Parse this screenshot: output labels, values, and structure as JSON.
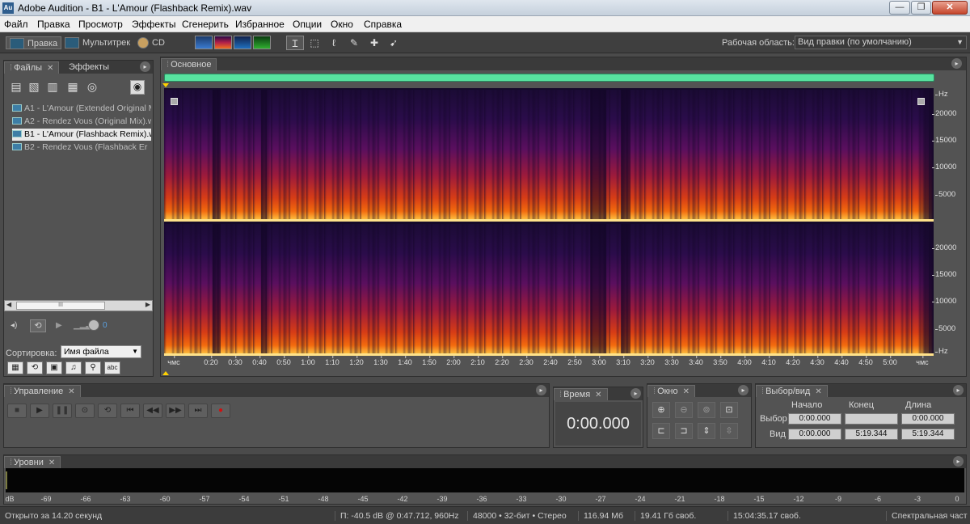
{
  "window": {
    "app_icon": "Au",
    "title": "Adobe Audition - B1 - L'Amour (Flashback Remix).wav",
    "min": "—",
    "max": "❐",
    "close": "✕"
  },
  "menu": [
    "Файл",
    "Правка",
    "Просмотр",
    "Эффекты",
    "Сгенерить",
    "Избранное",
    "Опции",
    "Окно",
    "Справка"
  ],
  "toolbar": {
    "edit": "Правка",
    "multitrack": "Мультитрек",
    "cd": "CD",
    "workspace_label": "Рабочая область:",
    "workspace_value": "Вид правки (по умолчанию)"
  },
  "files_panel": {
    "tab_files": "Файлы",
    "tab_effects": "Эффекты",
    "items": [
      {
        "label": "A1 - L'Amour (Extended Original M",
        "selected": false
      },
      {
        "label": "A2 - Rendez Vous (Original Mix).w",
        "selected": false
      },
      {
        "label": "B1 - L'Amour (Flashback Remix).w",
        "selected": true
      },
      {
        "label": "B2 - Rendez Vous (Flashback Er",
        "selected": false
      }
    ],
    "scroll_grip": "III",
    "sort_label": "Сортировка:",
    "sort_value": "Имя файла"
  },
  "editor": {
    "tab": "Основное",
    "hz_unit": "Hz",
    "channel1_hz": [
      "20000",
      "15000",
      "10000",
      "5000"
    ],
    "channel2_hz": [
      "20000",
      "15000",
      "10000",
      "5000"
    ],
    "time_unit": "чмс",
    "time_ticks": [
      "0:20",
      "0:30",
      "0:40",
      "0:50",
      "1:00",
      "1:10",
      "1:20",
      "1:30",
      "1:40",
      "1:50",
      "2:00",
      "2:10",
      "2:20",
      "2:30",
      "2:40",
      "2:50",
      "3:00",
      "3:10",
      "3:20",
      "3:30",
      "3:40",
      "3:50",
      "4:00",
      "4:10",
      "4:20",
      "4:30",
      "4:40",
      "4:50",
      "5:00"
    ]
  },
  "transport": {
    "tab": "Управление"
  },
  "time_panel": {
    "tab": "Время",
    "value": "0:00.000"
  },
  "zoom_panel": {
    "tab": "Окно"
  },
  "selection_panel": {
    "tab": "Выбор/вид",
    "col_start": "Начало",
    "col_end": "Конец",
    "col_length": "Длина",
    "row_selection": "Выбор",
    "row_view": "Вид",
    "selection": {
      "start": "0:00.000",
      "end": "",
      "length": "0:00.000"
    },
    "view": {
      "start": "0:00.000",
      "end": "5:19.344",
      "length": "5:19.344"
    }
  },
  "levels": {
    "tab": "Уровни",
    "ticks": [
      "dB",
      "-69",
      "-66",
      "-63",
      "-60",
      "-57",
      "-54",
      "-51",
      "-48",
      "-45",
      "-42",
      "-39",
      "-36",
      "-33",
      "-30",
      "-27",
      "-24",
      "-21",
      "-18",
      "-15",
      "-12",
      "-9",
      "-6",
      "-3",
      "0"
    ]
  },
  "status": {
    "opened": "Открыто за 14.20 секунд",
    "cursor": "П: -40.5 dB @  0:47.712, 960Hz",
    "format": "48000 • 32-бит • Стерео",
    "size": "116.94 Мб",
    "free": "19.41 Гб своб.",
    "time_free": "15:04:35.17 своб.",
    "view_mode": "Спектральная част"
  }
}
